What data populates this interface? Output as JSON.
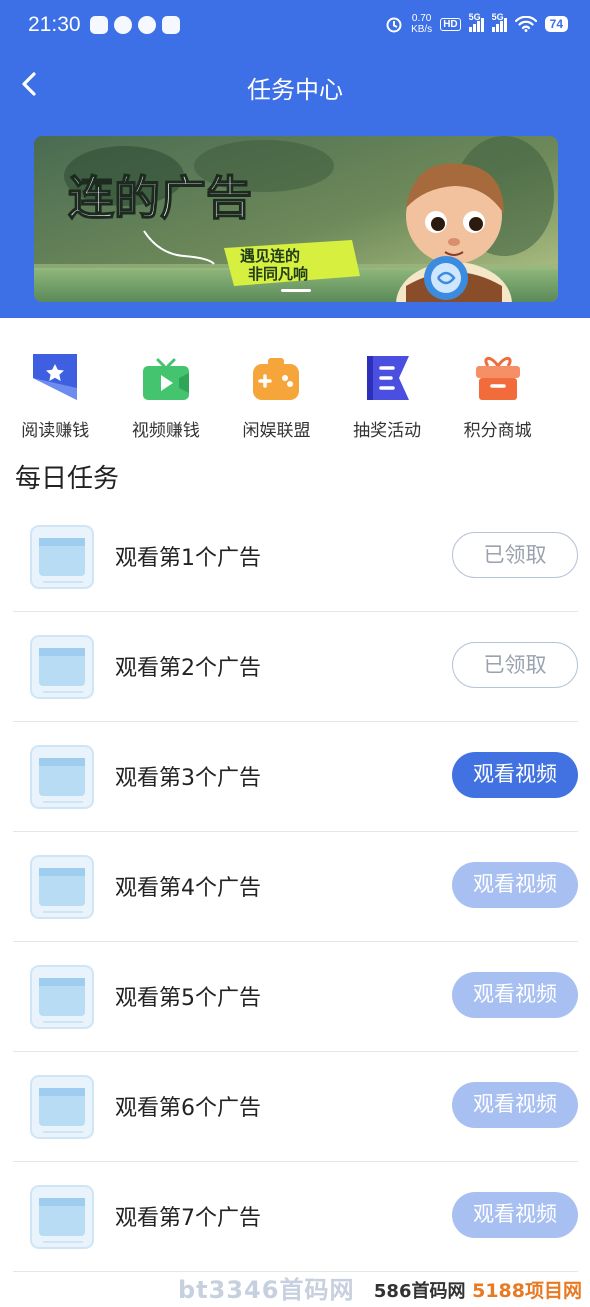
{
  "status_bar": {
    "time": "21:30",
    "net_speed_value": "0.70",
    "net_speed_unit": "KB/s",
    "hd_label": "HD",
    "sim1": "5G",
    "sim2": "5G",
    "battery": "74"
  },
  "nav": {
    "title": "任务中心",
    "back_icon": "chevron-left-icon"
  },
  "banner": {
    "headline": "连的广告",
    "bubble_line1": "遇见连的",
    "bubble_line2": "非同凡响"
  },
  "categories": [
    {
      "label": "阅读赚钱",
      "icon": "bookmark-star-icon",
      "color": "#3e5fe0"
    },
    {
      "label": "视频赚钱",
      "icon": "tv-play-icon",
      "color": "#45c46f"
    },
    {
      "label": "闲娱联盟",
      "icon": "gamepad-icon",
      "color": "#f6a53a"
    },
    {
      "label": "抽奖活动",
      "icon": "flag-icon",
      "color": "#4b4fe0"
    },
    {
      "label": "积分商城",
      "icon": "gift-icon",
      "color": "#f26b3a"
    }
  ],
  "section_title": "每日任务",
  "tasks": [
    {
      "label": "观看第1个广告",
      "button": "已领取",
      "state": "done"
    },
    {
      "label": "观看第2个广告",
      "button": "已领取",
      "state": "done"
    },
    {
      "label": "观看第3个广告",
      "button": "观看视频",
      "state": "active"
    },
    {
      "label": "观看第4个广告",
      "button": "观看视频",
      "state": "pending"
    },
    {
      "label": "观看第5个广告",
      "button": "观看视频",
      "state": "pending"
    },
    {
      "label": "观看第6个广告",
      "button": "观看视频",
      "state": "pending"
    },
    {
      "label": "观看第7个广告",
      "button": "观看视频",
      "state": "pending"
    }
  ],
  "watermark": {
    "left": "586首码网",
    "right": "5188项目网",
    "faint": "bt3346首码网"
  },
  "colors": {
    "header_blue": "#3d6fe7",
    "button_active": "#4272e2",
    "button_pending": "#a8bff2"
  }
}
